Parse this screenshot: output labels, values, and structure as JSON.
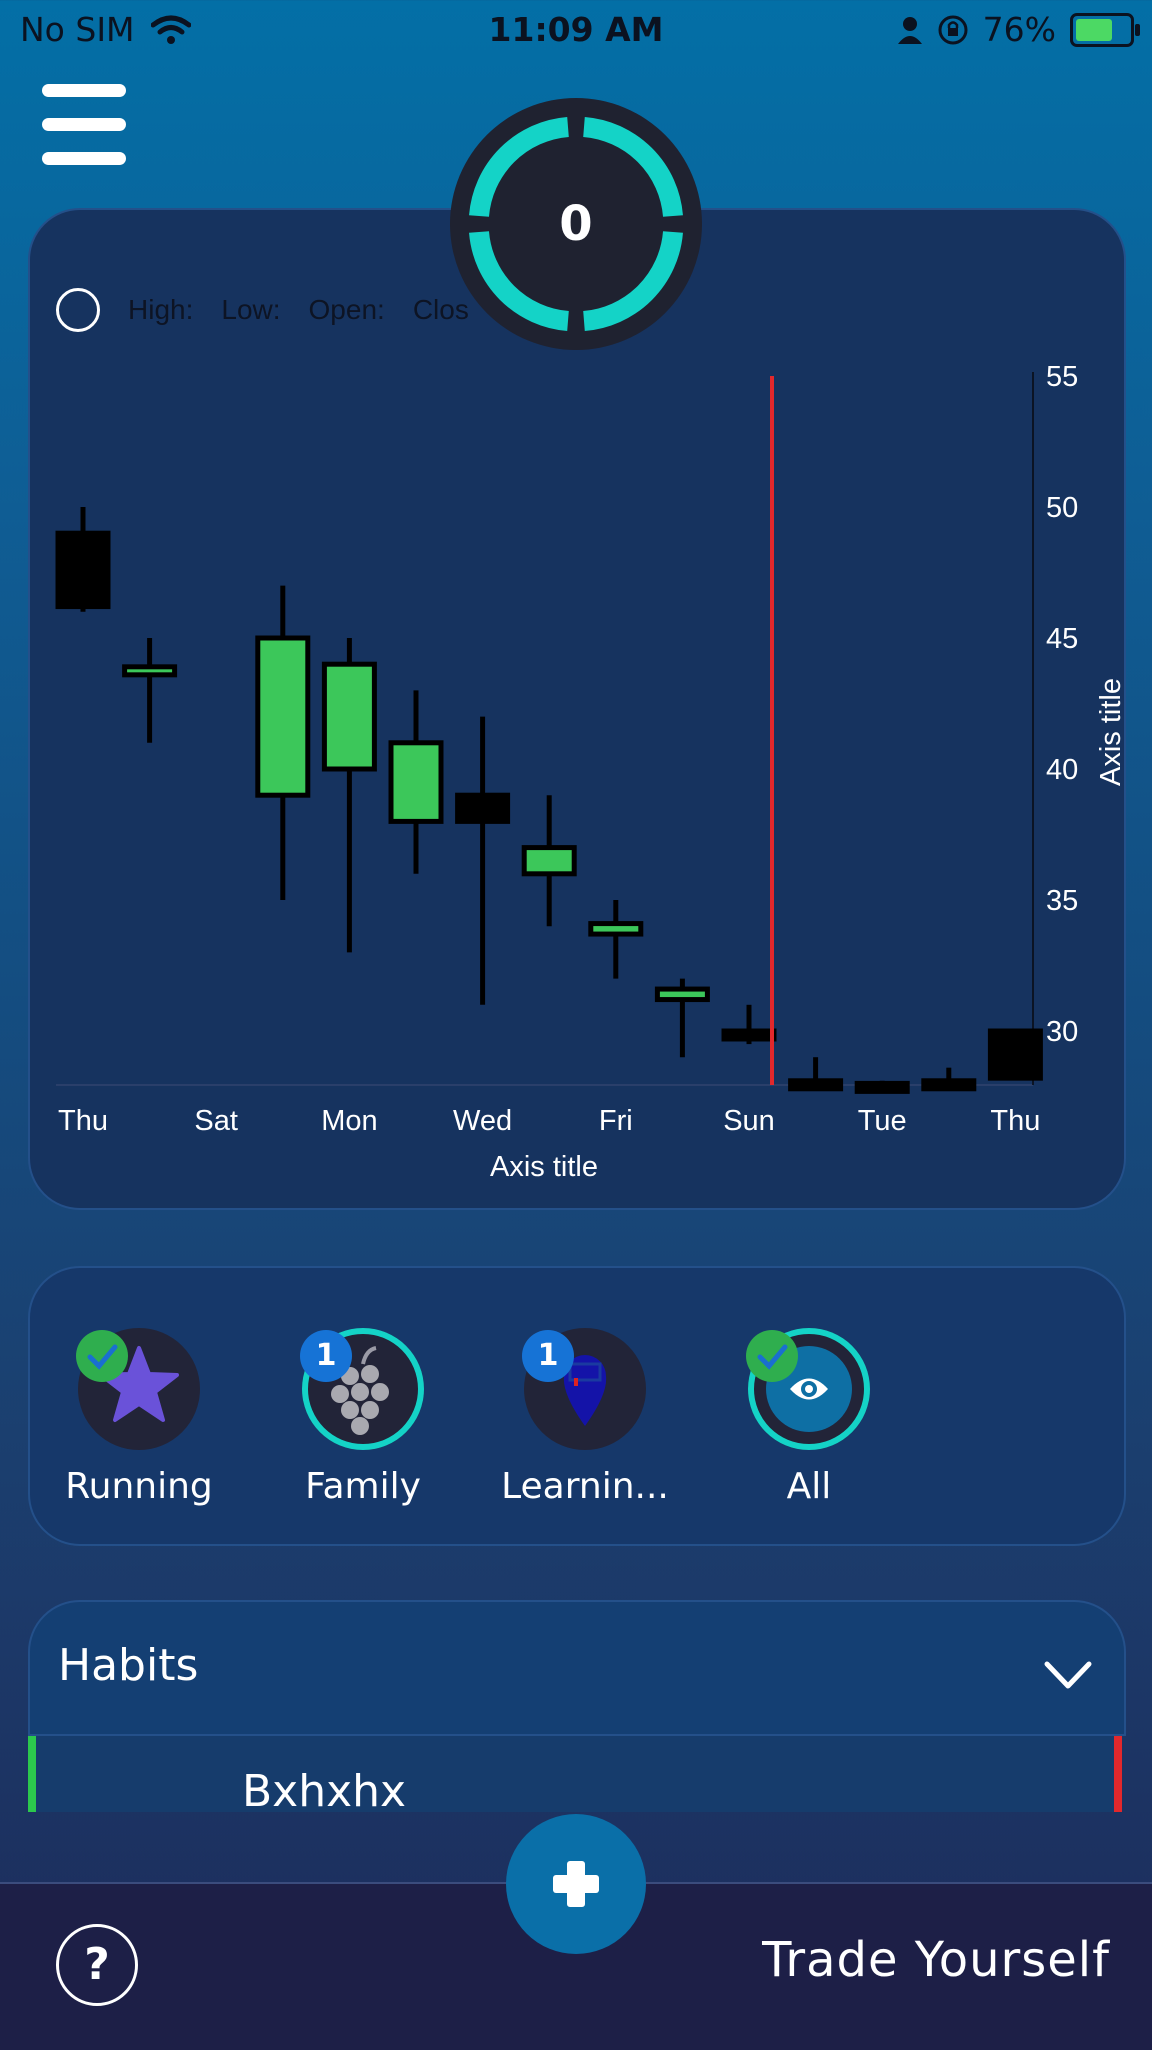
{
  "status_bar": {
    "carrier": "No SIM",
    "time": "11:09 AM",
    "battery": "76%"
  },
  "score": {
    "value": "0"
  },
  "legend": {
    "high": "High:",
    "low": "Low:",
    "open": "Open:",
    "close": "Clos"
  },
  "chart_data": {
    "type": "candlestick",
    "xlabel": "Axis title",
    "ylabel": "Axis title",
    "ylim": [
      28,
      55
    ],
    "yticks": [
      30,
      35,
      40,
      45,
      50,
      55
    ],
    "xtick_labels": [
      "Thu",
      "Sat",
      "Mon",
      "Wed",
      "Fri",
      "Sun",
      "Tue",
      "Thu"
    ],
    "marker_index": 10.5,
    "candles": [
      {
        "high": 50,
        "low": 46,
        "open": 49,
        "close": 46.2,
        "color": "black"
      },
      {
        "high": 45,
        "low": 41,
        "open": 43.6,
        "close": 43.9,
        "color": "green"
      },
      {
        "high": null,
        "low": null,
        "open": null,
        "close": null,
        "color": "none"
      },
      {
        "high": 47,
        "low": 35,
        "open": 39,
        "close": 45,
        "color": "green"
      },
      {
        "high": 45,
        "low": 33,
        "open": 40,
        "close": 44,
        "color": "green"
      },
      {
        "high": 43,
        "low": 36,
        "open": 38,
        "close": 41,
        "color": "green"
      },
      {
        "high": 42,
        "low": 31,
        "open": 39,
        "close": 38,
        "color": "black"
      },
      {
        "high": 39,
        "low": 34,
        "open": 36,
        "close": 37,
        "color": "green"
      },
      {
        "high": 35,
        "low": 32,
        "open": 33.7,
        "close": 34.1,
        "color": "green"
      },
      {
        "high": 32,
        "low": 29,
        "open": 31.2,
        "close": 31.6,
        "color": "green"
      },
      {
        "high": 31,
        "low": 29.5,
        "open": 30,
        "close": 29.7,
        "color": "black"
      },
      {
        "high": 29,
        "low": 28,
        "open": 28.1,
        "close": 28.1,
        "color": "black"
      },
      {
        "high": 28.1,
        "low": 28,
        "open": 28,
        "close": 28,
        "color": "black"
      },
      {
        "high": 28.6,
        "low": 28,
        "open": 28.1,
        "close": 28.1,
        "color": "black"
      },
      {
        "high": 30,
        "low": 28.2,
        "open": 30,
        "close": 28.2,
        "color": "black"
      }
    ],
    "colors": {
      "green": "#3cc75a",
      "black": "#000000",
      "marker": "#e2282c",
      "text": "#ffffff"
    }
  },
  "categories": [
    {
      "label": "Running",
      "badge": "check",
      "icon": "star-icon"
    },
    {
      "label": "Family",
      "badge": "1",
      "icon": "grapes-icon"
    },
    {
      "label": "Learnin...",
      "badge": "1",
      "icon": "map-pin-icon"
    },
    {
      "label": "All",
      "badge": "check",
      "icon": "eye-icon"
    }
  ],
  "habits": {
    "title": "Habits",
    "first_item": "Bxhxhx"
  },
  "bottom": {
    "help": "?",
    "brand": "Trade Yourself"
  }
}
